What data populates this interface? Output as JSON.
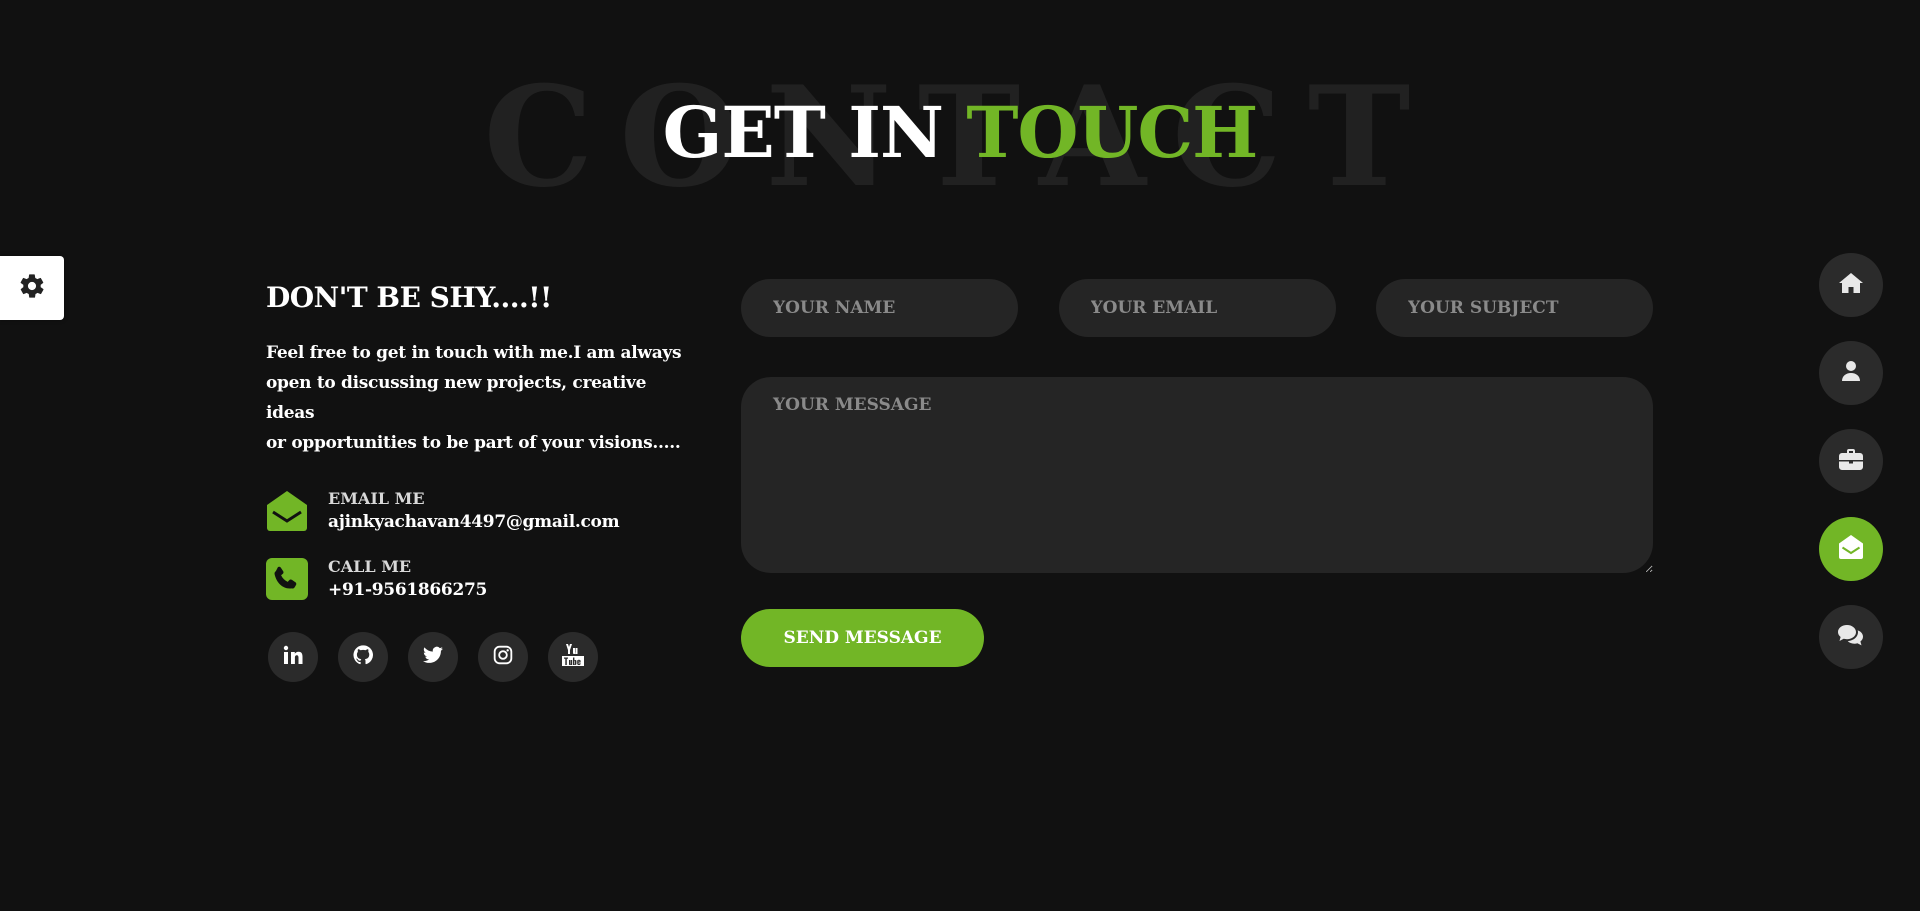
{
  "header": {
    "background_word": "CONTACT",
    "title_part1": "GET IN ",
    "title_accent": "TOUCH"
  },
  "left": {
    "heading": "DON'T BE SHY....!!",
    "intro_lines": [
      "Feel free to get in touch with me.I am always",
      "open to discussing new projects, creative ideas",
      "or opportunities to be part of your visions....."
    ],
    "email": {
      "label": "EMAIL ME",
      "value": "ajinkyachavan4497@gmail.com",
      "icon": "envelope-open-icon"
    },
    "phone": {
      "label": "CALL ME",
      "value": "+91-9561866275",
      "icon": "phone-icon"
    },
    "socials": [
      "linkedin-icon",
      "github-icon",
      "twitter-icon",
      "instagram-icon",
      "youtube-icon"
    ]
  },
  "form": {
    "name_placeholder": "YOUR NAME",
    "email_placeholder": "YOUR EMAIL",
    "subject_placeholder": "YOUR SUBJECT",
    "message_placeholder": "YOUR MESSAGE",
    "name_value": "",
    "email_value": "",
    "subject_value": "",
    "message_value": "",
    "submit_label": "SEND MESSAGE"
  },
  "nav": {
    "items": [
      "home-icon",
      "user-icon",
      "briefcase-icon",
      "envelope-open-icon",
      "comments-icon"
    ],
    "active": "envelope-open-icon"
  },
  "settings": {
    "icon": "gear-icon"
  },
  "colors": {
    "accent": "#72b626",
    "background": "#111111",
    "surface": "#252525",
    "button_dark": "#2b2b2b"
  }
}
